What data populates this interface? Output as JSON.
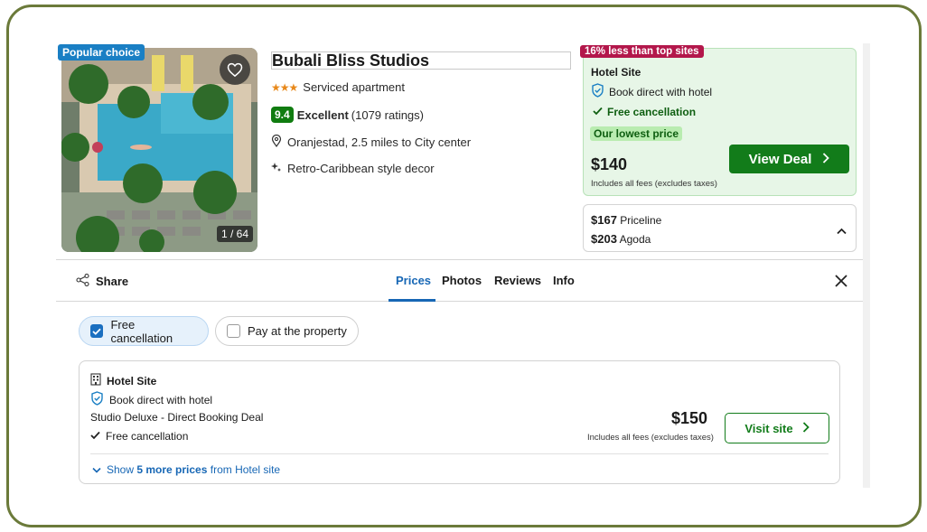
{
  "listing": {
    "badge": "Popular choice",
    "photo_counter": "1 / 64",
    "name": "Bubali Bliss Studios",
    "stars": "★★★",
    "type": "Serviced apartment",
    "score": "9.4",
    "rating_word": "Excellent",
    "ratings_count": "(1079 ratings)",
    "location": "Oranjestad, 2.5 miles to City center",
    "feature": "Retro-Caribbean style decor"
  },
  "deal": {
    "savings_badge": "16% less than top sites",
    "provider": "Hotel Site",
    "book_direct": "Book direct with hotel",
    "free_cancel": "Free cancellation",
    "lowest_label": "Our lowest price",
    "price": "$140",
    "fees_note": "Includes all fees (excludes taxes)",
    "cta": "View Deal"
  },
  "other_prices": [
    {
      "price": "$167",
      "site": "Priceline"
    },
    {
      "price": "$203",
      "site": "Agoda"
    }
  ],
  "tabs": {
    "share": "Share",
    "items": [
      "Prices",
      "Photos",
      "Reviews",
      "Info"
    ],
    "active": "Prices"
  },
  "filters": {
    "free_cancellation": "Free cancellation",
    "pay_at_property": "Pay at the property"
  },
  "offer": {
    "provider": "Hotel Site",
    "book_direct": "Book direct with hotel",
    "room": "Studio Deluxe - Direct Booking Deal",
    "cancel": "Free cancellation",
    "price": "$150",
    "fees_note": "Includes all fees (excludes taxes)",
    "cta": "Visit site",
    "show_more_prefix": "Show ",
    "show_more_bold": "5 more prices",
    "show_more_suffix": " from Hotel site"
  },
  "colors": {
    "accent_blue": "#1767b5",
    "deal_green": "#127c1a",
    "savings_red": "#b3174b",
    "frame_olive": "#6b7a3a"
  }
}
